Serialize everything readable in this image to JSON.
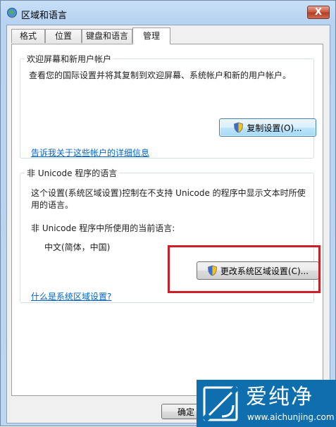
{
  "window": {
    "title": "区域和语言",
    "close_label": "X"
  },
  "tabs": [
    {
      "label": "格式",
      "active": false
    },
    {
      "label": "位置",
      "active": false
    },
    {
      "label": "键盘和语言",
      "active": false
    },
    {
      "label": "管理",
      "active": true
    }
  ],
  "welcome_group": {
    "title": "欢迎屏幕和新用户帐户",
    "description": "查看您的国际设置并将其复制到欢迎屏幕、系统帐户和新的用户帐户。",
    "copy_button": "复制设置(O)...",
    "link": "告诉我关于这些帐户的详细信息"
  },
  "unicode_group": {
    "title": "非 Unicode 程序的语言",
    "description": "这个设置(系统区域设置)控制在不支持 Unicode 的程序中显示文本时所使用的语言。",
    "current_label": "非 Unicode 程序中所使用的当前语言:",
    "current_value": "中文(简体，中国)",
    "change_button": "更改系统区域设置(C)...",
    "link": "什么是系统区域设置?"
  },
  "footer": {
    "ok_button": "确定"
  },
  "watermark": {
    "brand": "爱纯净",
    "url": "www.aichunjing.com"
  },
  "colors": {
    "highlight": "#cc1f27",
    "link": "#0066cc",
    "watermark_bg": "#0f6fae"
  }
}
